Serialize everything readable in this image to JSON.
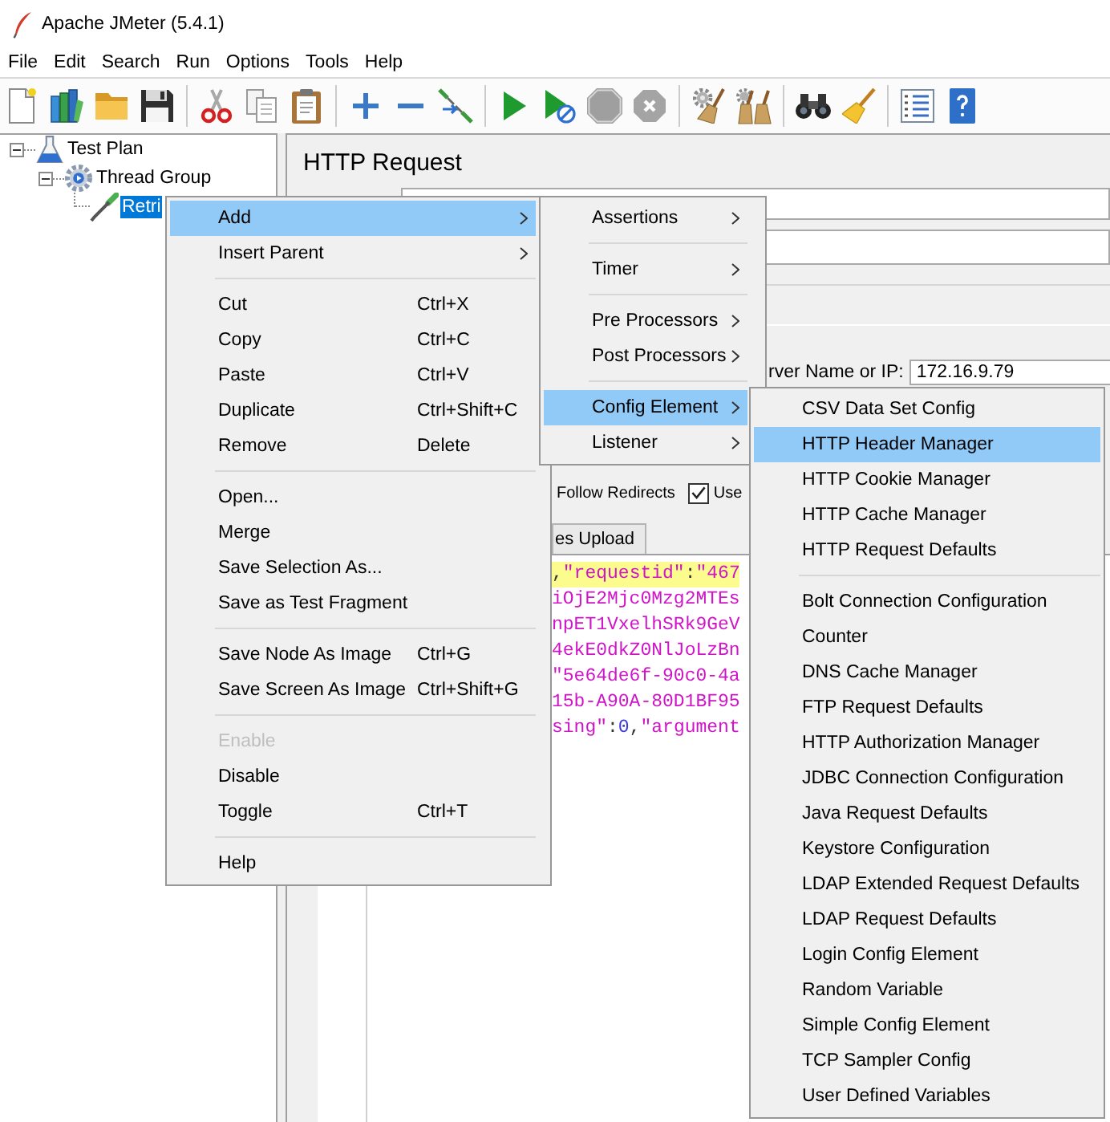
{
  "window": {
    "title": "Apache JMeter (5.4.1)"
  },
  "menu_bar": [
    "File",
    "Edit",
    "Search",
    "Run",
    "Options",
    "Tools",
    "Help"
  ],
  "toolbar": [
    {
      "kind": "new",
      "disabled": false
    },
    {
      "kind": "templates",
      "disabled": false
    },
    {
      "kind": "open",
      "disabled": false
    },
    {
      "kind": "save",
      "disabled": false
    },
    {
      "kind": "separator"
    },
    {
      "kind": "cut",
      "disabled": false
    },
    {
      "kind": "copy",
      "disabled": false
    },
    {
      "kind": "paste",
      "disabled": false
    },
    {
      "kind": "separator"
    },
    {
      "kind": "expand",
      "disabled": false
    },
    {
      "kind": "collapse",
      "disabled": false
    },
    {
      "kind": "toggle",
      "disabled": false
    },
    {
      "kind": "separator"
    },
    {
      "kind": "start",
      "disabled": false
    },
    {
      "kind": "start_no_pauses",
      "disabled": false
    },
    {
      "kind": "stop",
      "disabled": true
    },
    {
      "kind": "shutdown",
      "disabled": true
    },
    {
      "kind": "separator"
    },
    {
      "kind": "clear",
      "disabled": false
    },
    {
      "kind": "clear_all",
      "disabled": false
    },
    {
      "kind": "separator"
    },
    {
      "kind": "search",
      "disabled": false
    },
    {
      "kind": "reset_search",
      "disabled": false
    },
    {
      "kind": "separator"
    },
    {
      "kind": "function_helper",
      "disabled": false
    },
    {
      "kind": "help",
      "disabled": false
    }
  ],
  "tree": [
    {
      "kind": "test_plan",
      "label": "Test Plan",
      "expanded": true,
      "selected": false,
      "children": [
        {
          "kind": "thread_group",
          "label": "Thread Group",
          "expanded": true,
          "selected": false,
          "children": [
            {
              "kind": "sampler",
              "label": "Retri",
              "selected": true
            }
          ]
        }
      ]
    }
  ],
  "editor": {
    "title": "HTTP Request",
    "server_label": "rver Name or IP:",
    "server_value": "172.16.9.79",
    "options": [
      {
        "kind": "label",
        "label": "Follow Redirects"
      },
      {
        "kind": "checkbox",
        "label": "Use",
        "checked": true
      }
    ],
    "body_tabs": [
      {
        "label": "es Upload",
        "selected": false
      }
    ],
    "body_lines": [
      {
        "highlighted": true,
        "tokens": [
          {
            "kind": "punct",
            "text": ","
          },
          {
            "kind": "string",
            "text": "\"requestid\""
          },
          {
            "kind": "punct",
            "text": ":"
          },
          {
            "kind": "string",
            "text": "\"467"
          }
        ]
      },
      {
        "highlighted": false,
        "tokens": [
          {
            "kind": "string",
            "text": "iOjE2Mjc0Mzg2MTEs"
          }
        ]
      },
      {
        "highlighted": false,
        "tokens": [
          {
            "kind": "string",
            "text": "npET1VxelhSRk9GeV"
          }
        ]
      },
      {
        "highlighted": false,
        "tokens": [
          {
            "kind": "string",
            "text": "4ekE0dkZ0NlJoLzBn"
          }
        ]
      },
      {
        "highlighted": false,
        "tokens": [
          {
            "kind": "string",
            "text": "\"5e64de6f-90c0-4a"
          }
        ]
      },
      {
        "highlighted": false,
        "tokens": [
          {
            "kind": "string",
            "text": "15b-A90A-80D1BF95"
          }
        ]
      },
      {
        "highlighted": false,
        "tokens": [
          {
            "kind": "string",
            "text": "sing\""
          },
          {
            "kind": "punct",
            "text": ":"
          },
          {
            "kind": "number",
            "text": "0"
          },
          {
            "kind": "punct",
            "text": ","
          },
          {
            "kind": "string",
            "text": "\"argument"
          }
        ]
      }
    ]
  },
  "context_menu": {
    "sections": [
      {
        "items": [
          {
            "label": "Add",
            "submenu": true,
            "selected": true,
            "disabled": false
          },
          {
            "label": "Insert Parent",
            "submenu": true,
            "selected": false,
            "disabled": false
          }
        ]
      },
      {
        "items": [
          {
            "label": "Cut",
            "shortcut": "Ctrl+X",
            "submenu": false,
            "selected": false,
            "disabled": false
          },
          {
            "label": "Copy",
            "shortcut": "Ctrl+C",
            "submenu": false,
            "selected": false,
            "disabled": false
          },
          {
            "label": "Paste",
            "shortcut": "Ctrl+V",
            "submenu": false,
            "selected": false,
            "disabled": false
          },
          {
            "label": "Duplicate",
            "shortcut": "Ctrl+Shift+C",
            "submenu": false,
            "selected": false,
            "disabled": false
          },
          {
            "label": "Remove",
            "shortcut": "Delete",
            "submenu": false,
            "selected": false,
            "disabled": false
          }
        ]
      },
      {
        "items": [
          {
            "label": "Open...",
            "submenu": false,
            "selected": false,
            "disabled": false
          },
          {
            "label": "Merge",
            "submenu": false,
            "selected": false,
            "disabled": false
          },
          {
            "label": "Save Selection As...",
            "submenu": false,
            "selected": false,
            "disabled": false
          },
          {
            "label": "Save as Test Fragment",
            "submenu": false,
            "selected": false,
            "disabled": false
          }
        ]
      },
      {
        "items": [
          {
            "label": "Save Node As Image",
            "shortcut": "Ctrl+G",
            "submenu": false,
            "selected": false,
            "disabled": false
          },
          {
            "label": "Save Screen As Image",
            "shortcut": "Ctrl+Shift+G",
            "submenu": false,
            "selected": false,
            "disabled": false
          }
        ]
      },
      {
        "items": [
          {
            "label": "Enable",
            "submenu": false,
            "selected": false,
            "disabled": true
          },
          {
            "label": "Disable",
            "submenu": false,
            "selected": false,
            "disabled": false
          },
          {
            "label": "Toggle",
            "shortcut": "Ctrl+T",
            "submenu": false,
            "selected": false,
            "disabled": false
          }
        ]
      },
      {
        "items": [
          {
            "label": "Help",
            "submenu": false,
            "selected": false,
            "disabled": false
          }
        ]
      }
    ]
  },
  "add_submenu": {
    "sections": [
      {
        "items": [
          {
            "label": "Assertions",
            "submenu": true,
            "selected": false
          }
        ]
      },
      {
        "items": [
          {
            "label": "Timer",
            "submenu": true,
            "selected": false
          }
        ]
      },
      {
        "items": [
          {
            "label": "Pre Processors",
            "submenu": true,
            "selected": false
          },
          {
            "label": "Post Processors",
            "submenu": true,
            "selected": false
          }
        ]
      },
      {
        "items": [
          {
            "label": "Config Element",
            "submenu": true,
            "selected": true
          },
          {
            "label": "Listener",
            "submenu": true,
            "selected": false
          }
        ]
      }
    ]
  },
  "config_element_submenu": {
    "sections": [
      {
        "items": [
          {
            "label": "CSV Data Set Config",
            "selected": false
          },
          {
            "label": "HTTP Header Manager",
            "selected": true
          },
          {
            "label": "HTTP Cookie Manager",
            "selected": false
          },
          {
            "label": "HTTP Cache Manager",
            "selected": false
          },
          {
            "label": "HTTP Request Defaults",
            "selected": false
          }
        ]
      },
      {
        "items": [
          {
            "label": "Bolt Connection Configuration",
            "selected": false
          },
          {
            "label": "Counter",
            "selected": false
          },
          {
            "label": "DNS Cache Manager",
            "selected": false
          },
          {
            "label": "FTP Request Defaults",
            "selected": false
          },
          {
            "label": "HTTP Authorization Manager",
            "selected": false
          },
          {
            "label": "JDBC Connection Configuration",
            "selected": false
          },
          {
            "label": "Java Request Defaults",
            "selected": false
          },
          {
            "label": "Keystore Configuration",
            "selected": false
          },
          {
            "label": "LDAP Extended Request Defaults",
            "selected": false
          },
          {
            "label": "LDAP Request Defaults",
            "selected": false
          },
          {
            "label": "Login Config Element",
            "selected": false
          },
          {
            "label": "Random Variable",
            "selected": false
          },
          {
            "label": "Simple Config Element",
            "selected": false
          },
          {
            "label": "TCP Sampler Config",
            "selected": false
          },
          {
            "label": "User Defined Variables",
            "selected": false
          }
        ]
      }
    ]
  }
}
